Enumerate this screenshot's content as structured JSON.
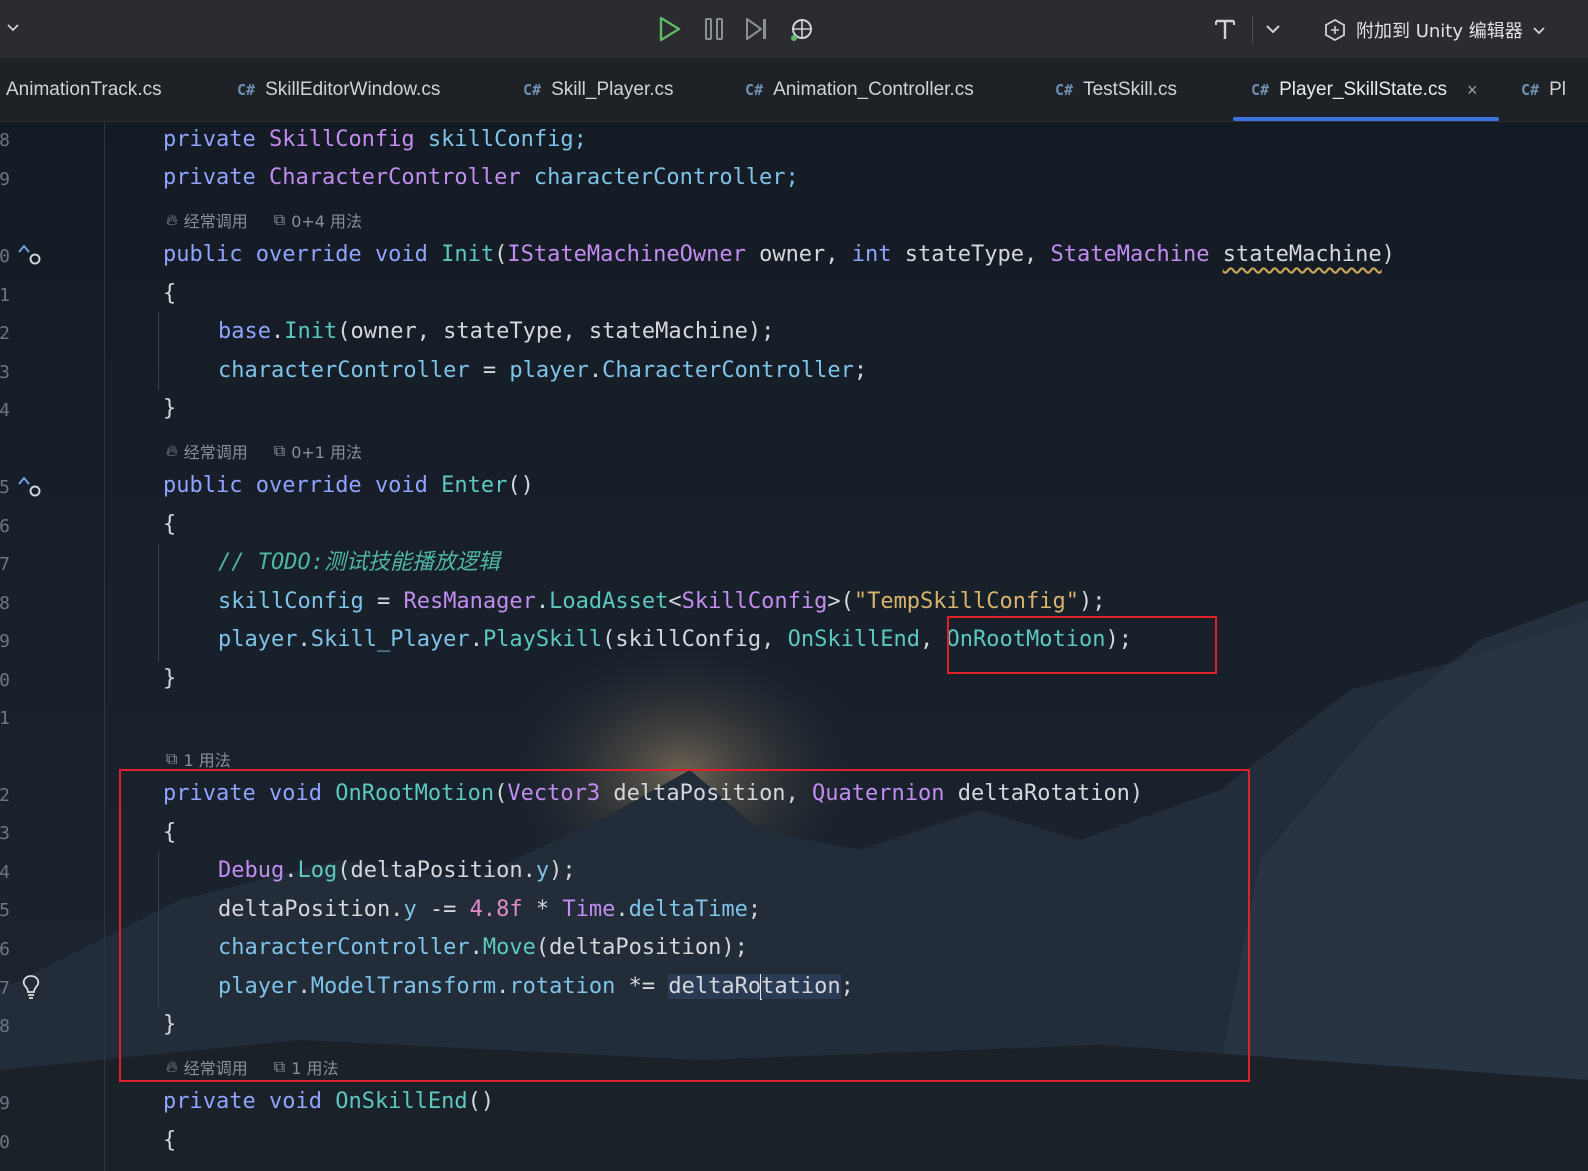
{
  "toolbar": {
    "attach_label": "附加到 Unity 编辑器",
    "buttons": [
      "run-icon",
      "pause-icon",
      "step-icon",
      "debug-icon",
      "format-icon",
      "chevron-down-icon"
    ]
  },
  "tabs": [
    {
      "label": "AnimationTrack.cs",
      "cs": ""
    },
    {
      "label": "SkillEditorWindow.cs",
      "cs": "C#"
    },
    {
      "label": "Skill_Player.cs",
      "cs": "C#"
    },
    {
      "label": "Animation_Controller.cs",
      "cs": "C#"
    },
    {
      "label": "TestSkill.cs",
      "cs": "C#"
    },
    {
      "label": "Player_SkillState.cs",
      "cs": "C#",
      "active": true,
      "close": "×"
    },
    {
      "label": "Pl",
      "cs": "C#"
    }
  ],
  "gutter": {
    "line_digits": [
      "8",
      "9",
      "0",
      "1",
      "2",
      "3",
      "4",
      "5",
      "6",
      "7",
      "8",
      "9",
      "0",
      "1",
      "2",
      "3",
      "4",
      "5",
      "6",
      "7",
      "8",
      "9",
      "0"
    ]
  },
  "hints": {
    "init_freq": "经常调用",
    "init_usage": "0+4 用法",
    "enter_freq": "经常调用",
    "enter_usage": "0+1 用法",
    "rootmotion_usage": "1 用法",
    "skillend_freq": "经常调用",
    "skillend_usage": "1 用法"
  },
  "code": {
    "l1": [
      "private ",
      "SkillConfig",
      " skillConfig;"
    ],
    "l2": [
      "private ",
      "CharacterController",
      " characterController;"
    ],
    "l3": [
      "public ",
      "override ",
      "void ",
      "Init",
      "(",
      "IStateMachineOwner",
      " owner, ",
      "int",
      " stateType, ",
      "StateMachine",
      " ",
      "stateMachine",
      ")"
    ],
    "brace_open": "{",
    "brace_close": "}",
    "l5": [
      "base",
      ".",
      "Init",
      "(owner, stateType, stateMachine);"
    ],
    "l6": [
      "characterController",
      " = ",
      "player",
      ".",
      "CharacterController",
      ";"
    ],
    "l8": [
      "public ",
      "override ",
      "void ",
      "Enter",
      "()"
    ],
    "l10": "// TODO:测试技能播放逻辑",
    "l11": [
      "skillConfig",
      " = ",
      "ResManager",
      ".",
      "LoadAsset",
      "<",
      "SkillConfig",
      ">(",
      "\"TempSkillConfig\"",
      ");"
    ],
    "l12": [
      "player",
      ".",
      "Skill_Player",
      ".",
      "PlaySkill",
      "(skillConfig, ",
      "OnSkillEnd",
      ", ",
      "OnRootMotion",
      ");"
    ],
    "l15": [
      "private ",
      "void ",
      "OnRootMotion",
      "(",
      "Vector3",
      " deltaPosition, ",
      "Quaternion",
      " deltaRotation)"
    ],
    "l17": [
      "Debug",
      ".",
      "Log",
      "(deltaPosition.",
      "y",
      ");"
    ],
    "l18": [
      "deltaPosition.",
      "y",
      " -= ",
      "4.8f",
      " * ",
      "Time",
      ".",
      "deltaTime",
      ";"
    ],
    "l19": [
      "characterController",
      ".",
      "Move",
      "(deltaPosition);"
    ],
    "l20": [
      "player",
      ".",
      "ModelTransform",
      ".",
      "rotation",
      " *= ",
      "deltaRo",
      "tation",
      ";"
    ],
    "l23": [
      "private ",
      "void ",
      "OnSkillEnd",
      "()"
    ]
  }
}
